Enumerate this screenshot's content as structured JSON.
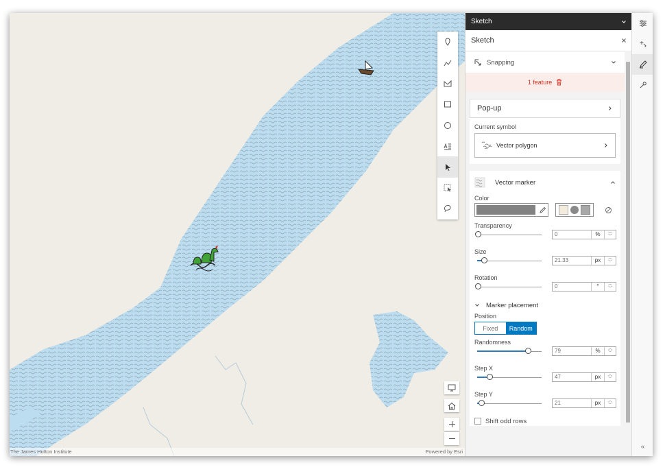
{
  "map": {
    "attribution_left": "The James Hutton Institute",
    "attribution_right": "Powered by Esri"
  },
  "drawing_tools": [
    "point-icon",
    "polyline-icon",
    "polygon-icon",
    "rectangle-icon",
    "circle-icon",
    "text-icon",
    "select-icon",
    "rectangle-select-icon",
    "lasso-select-icon"
  ],
  "panel": {
    "header_title": "Sketch",
    "title": "Sketch",
    "snapping_label": "Snapping",
    "feature_count": "1 feature",
    "popup_label": "Pop-up",
    "current_symbol_label": "Current symbol",
    "current_symbol_value": "Vector polygon",
    "vector_marker_label": "Vector marker",
    "color_label": "Color",
    "color_value": "#828282",
    "swatch_colors": [
      "#f3ecdc",
      "#8a8a8a",
      "#a8a8a8"
    ],
    "transparency": {
      "label": "Transparency",
      "value": "0",
      "unit": "%"
    },
    "size": {
      "label": "Size",
      "value": "21.33",
      "unit": "px"
    },
    "rotation": {
      "label": "Rotation",
      "value": "0",
      "unit": "°"
    },
    "marker_placement_label": "Marker placement",
    "position_label": "Position",
    "position_options": [
      "Fixed",
      "Random"
    ],
    "position_selected": "Random",
    "randomness": {
      "label": "Randomness",
      "value": "79",
      "unit": "%"
    },
    "step_x": {
      "label": "Step X",
      "value": "47",
      "unit": "px"
    },
    "step_y": {
      "label": "Step Y",
      "value": "21",
      "unit": "px"
    },
    "shift_odd_rows_label": "Shift odd rows"
  },
  "actions": [
    "settings-icon",
    "add-icon",
    "sketch-icon",
    "wrench-icon"
  ],
  "colors": {
    "water": "#bcdcef",
    "land": "#efede6",
    "brand_blue": "#0079c1",
    "danger": "#d83020"
  }
}
